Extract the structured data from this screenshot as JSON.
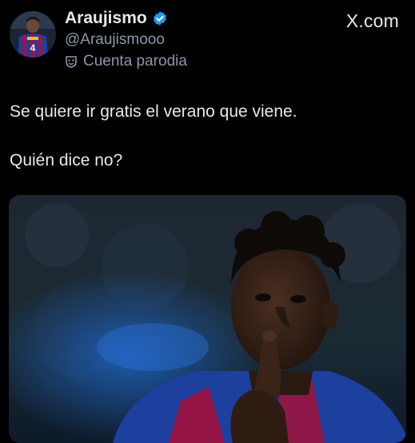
{
  "tweet": {
    "author": {
      "display_name": "Araujismo",
      "handle": "@Araujismooo",
      "label": "Cuenta parodia",
      "verified_color": "#1d9bf0",
      "avatar_jersey_number": "4"
    },
    "brand": "X.com",
    "text_lines": [
      "Se quiere ir gratis el verano que viene.",
      "Quién dice no?"
    ],
    "media": {
      "type": "photo"
    }
  },
  "colors": {
    "background": "#000000",
    "text": "#e7e9ea",
    "secondary_text": "#8b98a5",
    "accent": "#1d9bf0",
    "jersey_blue": "#1d3f9e",
    "jersey_red": "#a3123a"
  },
  "icons": {
    "verified": "verified-badge-icon",
    "parody": "parody-mask-icon"
  }
}
